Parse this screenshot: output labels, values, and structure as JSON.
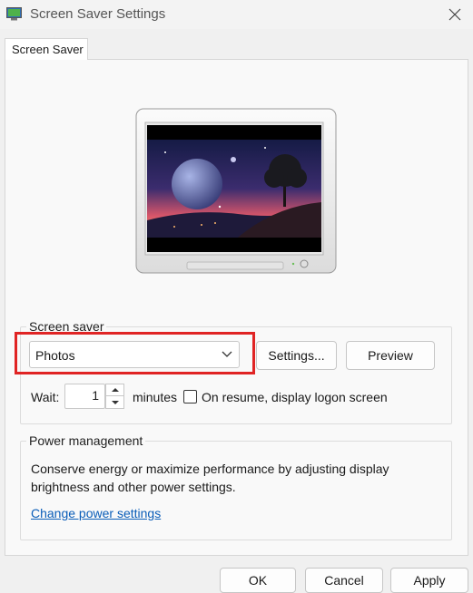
{
  "window": {
    "title": "Screen Saver Settings"
  },
  "tabs": [
    {
      "label": "Screen Saver"
    }
  ],
  "screen_saver": {
    "group_label": "Screen saver",
    "selected": "Photos",
    "settings_label": "Settings...",
    "preview_label": "Preview",
    "wait_label": "Wait:",
    "wait_value": "1",
    "minutes_label": "minutes",
    "resume_checked": false,
    "resume_label": "On resume, display logon screen"
  },
  "power": {
    "group_label": "Power management",
    "description": "Conserve energy or maximize performance by adjusting display brightness and other power settings.",
    "link_label": "Change power settings"
  },
  "buttons": {
    "ok": "OK",
    "cancel": "Cancel",
    "apply": "Apply"
  },
  "colors": {
    "highlight": "#e02424",
    "link": "#0a5db8"
  }
}
